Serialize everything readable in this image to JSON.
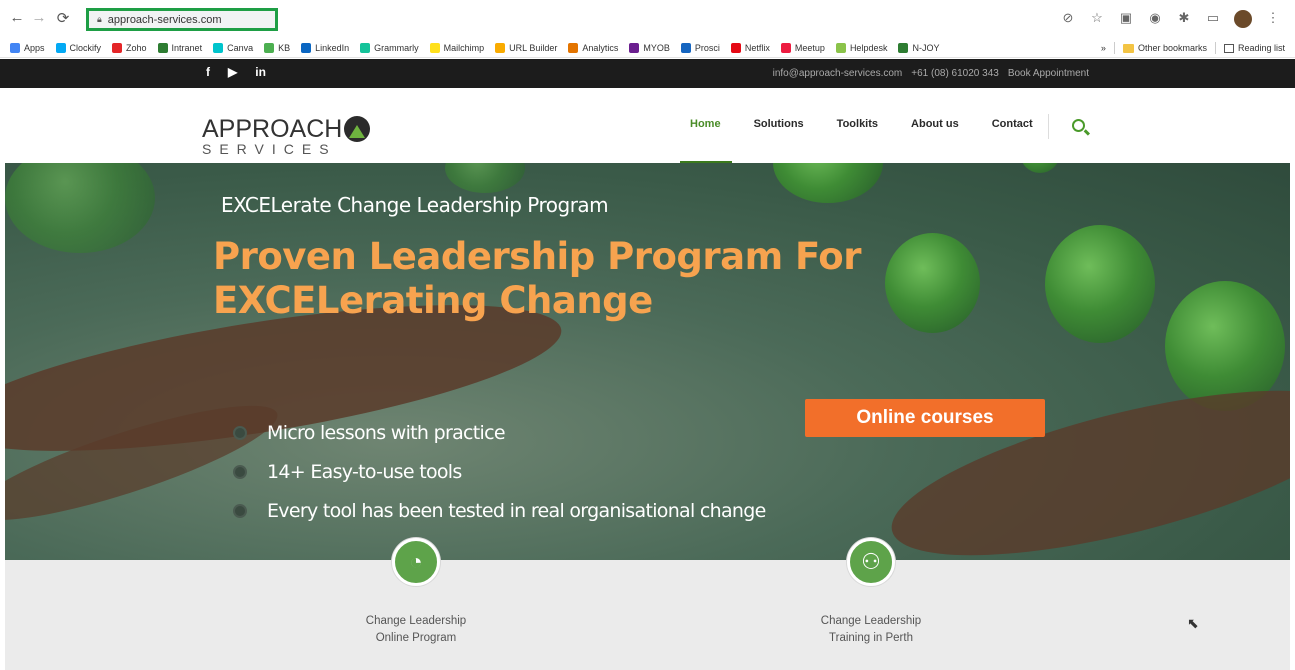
{
  "browser": {
    "url": "approach-services.com",
    "bookmarks": [
      {
        "label": "Apps",
        "color": "#4285f4"
      },
      {
        "label": "Clockify",
        "color": "#03a9f4"
      },
      {
        "label": "Zoho",
        "color": "#e42527"
      },
      {
        "label": "Intranet",
        "color": "#2e7d32"
      },
      {
        "label": "Canva",
        "color": "#00c4cc"
      },
      {
        "label": "KB",
        "color": "#4caf50"
      },
      {
        "label": "LinkedIn",
        "color": "#0a66c2"
      },
      {
        "label": "Grammarly",
        "color": "#15c39a"
      },
      {
        "label": "Mailchimp",
        "color": "#ffe01b"
      },
      {
        "label": "URL Builder",
        "color": "#f9ab00"
      },
      {
        "label": "Analytics",
        "color": "#e37400"
      },
      {
        "label": "MYOB",
        "color": "#6b1f8f"
      },
      {
        "label": "Prosci",
        "color": "#1565c0"
      },
      {
        "label": "Netflix",
        "color": "#e50914"
      },
      {
        "label": "Meetup",
        "color": "#ed1c40"
      },
      {
        "label": "Helpdesk",
        "color": "#8bc34a"
      },
      {
        "label": "N-JOY",
        "color": "#2e7d32"
      }
    ],
    "bookmarks_overflow": "»",
    "other_bookmarks": "Other bookmarks",
    "reading_list": "Reading list"
  },
  "topbar": {
    "social": [
      "f",
      "▶",
      "in"
    ],
    "email": "info@approach-services.com",
    "phone": "+61 (08) 61020 343",
    "book": "Book Appointment"
  },
  "header": {
    "logo_line1": "APPROACH",
    "logo_line2": "SERVICES",
    "nav": [
      "Home",
      "Solutions",
      "Toolkits",
      "About us",
      "Contact"
    ],
    "active_nav": "Home"
  },
  "hero": {
    "subtitle": "EXCELerate Change Leadership Program",
    "title_line1": "Proven Leadership Program For",
    "title_line2": "EXCELerating Change",
    "cta": "Online courses",
    "bullets": [
      "Micro lessons with practice",
      "14+ Easy-to-use tools",
      "Every tool has been tested in real organisational change"
    ]
  },
  "features": [
    {
      "line1": "Change Leadership",
      "line2": "Online Program",
      "icon": "globe-icon"
    },
    {
      "line1": "Change Leadership",
      "line2": "Training in Perth",
      "icon": "group-icon"
    }
  ],
  "colors": {
    "accent_green": "#4a8c28",
    "cta_orange": "#f26f2a",
    "title_orange": "#f7a34f",
    "url_highlight": "#1e9e45"
  }
}
